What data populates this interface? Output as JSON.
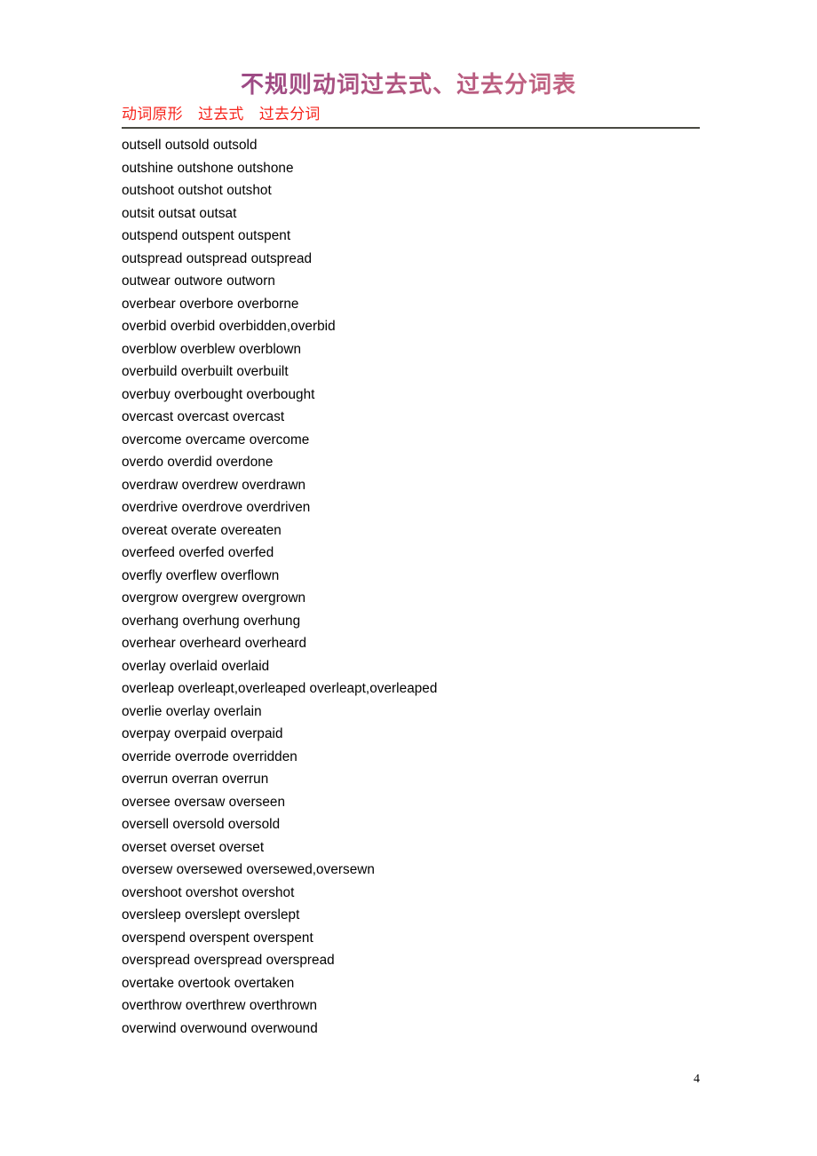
{
  "document": {
    "title": "不规则动词过去式、过去分词表",
    "title_gradient_start": "#7b3f8c",
    "title_gradient_end": "#d07b97",
    "page_number": "4"
  },
  "table": {
    "header_text": "动词原形　过去式　过去分词",
    "header_color": "#f6241c",
    "rule_color": "#4a4a42",
    "columns": [
      "动词原形",
      "过去式",
      "过去分词"
    ],
    "rows": [
      {
        "line": "outsell outsold outsold",
        "base": "outsell",
        "past": "outsold",
        "participle": "outsold"
      },
      {
        "line": "outshine outshone outshone",
        "base": "outshine",
        "past": "outshone",
        "participle": "outshone"
      },
      {
        "line": "outshoot outshot outshot",
        "base": "outshoot",
        "past": "outshot",
        "participle": "outshot"
      },
      {
        "line": "outsit outsat outsat",
        "base": "outsit",
        "past": "outsat",
        "participle": "outsat"
      },
      {
        "line": "outspend outspent outspent",
        "base": "outspend",
        "past": "outspent",
        "participle": "outspent"
      },
      {
        "line": "outspread outspread outspread",
        "base": "outspread",
        "past": "outspread",
        "participle": "outspread"
      },
      {
        "line": "outwear outwore outworn",
        "base": "outwear",
        "past": "outwore",
        "participle": "outworn"
      },
      {
        "line": "overbear overbore overborne",
        "base": "overbear",
        "past": "overbore",
        "participle": "overborne"
      },
      {
        "line": "overbid overbid overbidden,overbid",
        "base": "overbid",
        "past": "overbid",
        "participle": "overbidden,overbid"
      },
      {
        "line": "overblow overblew overblown",
        "base": "overblow",
        "past": "overblew",
        "participle": "overblown"
      },
      {
        "line": "overbuild overbuilt overbuilt",
        "base": "overbuild",
        "past": "overbuilt",
        "participle": "overbuilt"
      },
      {
        "line": "overbuy overbought overbought",
        "base": "overbuy",
        "past": "overbought",
        "participle": "overbought"
      },
      {
        "line": "overcast overcast overcast",
        "base": "overcast",
        "past": "overcast",
        "participle": "overcast"
      },
      {
        "line": "overcome overcame overcome",
        "base": "overcome",
        "past": "overcame",
        "participle": "overcome"
      },
      {
        "line": "overdo overdid overdone",
        "base": "overdo",
        "past": "overdid",
        "participle": "overdone"
      },
      {
        "line": "overdraw overdrew overdrawn",
        "base": "overdraw",
        "past": "overdrew",
        "participle": "overdrawn"
      },
      {
        "line": "overdrive overdrove overdriven",
        "base": "overdrive",
        "past": "overdrove",
        "participle": "overdriven"
      },
      {
        "line": "overeat overate overeaten",
        "base": "overeat",
        "past": "overate",
        "participle": "overeaten"
      },
      {
        "line": "overfeed overfed overfed",
        "base": "overfeed",
        "past": "overfed",
        "participle": "overfed"
      },
      {
        "line": "overfly overflew overflown",
        "base": "overfly",
        "past": "overflew",
        "participle": "overflown"
      },
      {
        "line": "overgrow overgrew overgrown",
        "base": "overgrow",
        "past": "overgrew",
        "participle": "overgrown"
      },
      {
        "line": "overhang overhung overhung",
        "base": "overhang",
        "past": "overhung",
        "participle": "overhung"
      },
      {
        "line": "overhear overheard overheard",
        "base": "overhear",
        "past": "overheard",
        "participle": "overheard"
      },
      {
        "line": "overlay overlaid overlaid",
        "base": "overlay",
        "past": "overlaid",
        "participle": "overlaid"
      },
      {
        "line": "overleap overleapt,overleaped overleapt,overleaped",
        "base": "overleap",
        "past": "overleapt,overleaped",
        "participle": "overleapt,overleaped"
      },
      {
        "line": "overlie overlay overlain",
        "base": "overlie",
        "past": "overlay",
        "participle": "overlain"
      },
      {
        "line": "overpay overpaid overpaid",
        "base": "overpay",
        "past": "overpaid",
        "participle": "overpaid"
      },
      {
        "line": "override overrode overridden",
        "base": "override",
        "past": "overrode",
        "participle": "overridden"
      },
      {
        "line": "overrun overran overrun",
        "base": "overrun",
        "past": "overran",
        "participle": "overrun"
      },
      {
        "line": "oversee oversaw overseen",
        "base": "oversee",
        "past": "oversaw",
        "participle": "overseen"
      },
      {
        "line": "oversell oversold oversold",
        "base": "oversell",
        "past": "oversold",
        "participle": "oversold"
      },
      {
        "line": "overset overset overset",
        "base": "overset",
        "past": "overset",
        "participle": "overset"
      },
      {
        "line": "oversew oversewed oversewed,oversewn",
        "base": "oversew",
        "past": "oversewed",
        "participle": "oversewed,oversewn"
      },
      {
        "line": "overshoot overshot overshot",
        "base": "overshoot",
        "past": "overshot",
        "participle": "overshot"
      },
      {
        "line": "oversleep overslept overslept",
        "base": "oversleep",
        "past": "overslept",
        "participle": "overslept"
      },
      {
        "line": "overspend overspent overspent",
        "base": "overspend",
        "past": "overspent",
        "participle": "overspent"
      },
      {
        "line": "overspread overspread overspread",
        "base": "overspread",
        "past": "overspread",
        "participle": "overspread"
      },
      {
        "line": "overtake overtook overtaken",
        "base": "overtake",
        "past": "overtook",
        "participle": "overtaken"
      },
      {
        "line": "overthrow overthrew overthrown",
        "base": "overthrow",
        "past": "overthrew",
        "participle": "overthrown"
      },
      {
        "line": "overwind overwound overwound",
        "base": "overwind",
        "past": "overwound",
        "participle": "overwound"
      }
    ]
  }
}
